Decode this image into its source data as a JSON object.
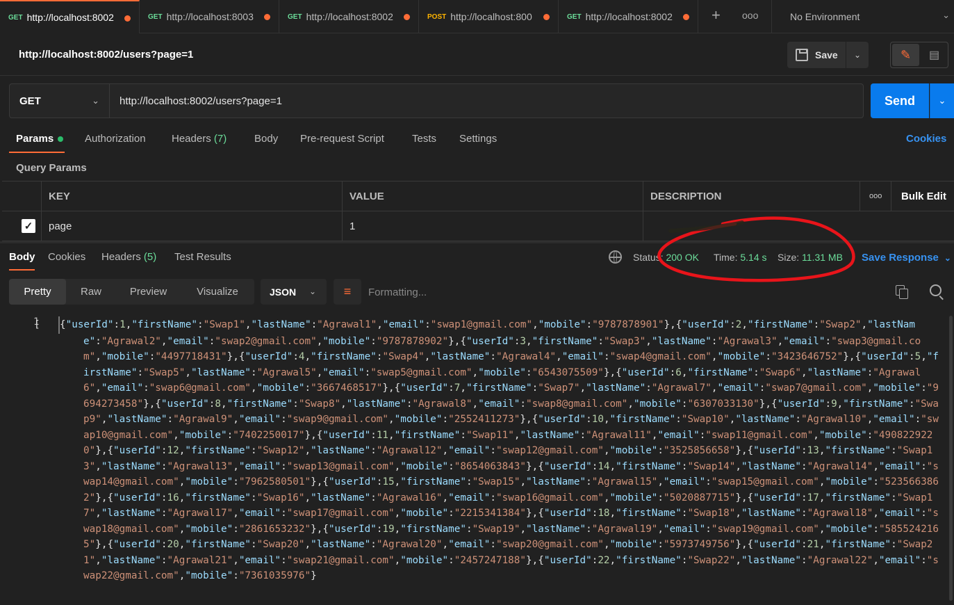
{
  "tabs": [
    {
      "method": "GET",
      "url": "http://localhost:8002",
      "active": true
    },
    {
      "method": "GET",
      "url": "http://localhost:8003",
      "active": false
    },
    {
      "method": "GET",
      "url": "http://localhost:8002",
      "active": false
    },
    {
      "method": "POST",
      "url": "http://localhost:800",
      "active": false
    },
    {
      "method": "GET",
      "url": "http://localhost:8002",
      "active": false
    }
  ],
  "tab_actions": {
    "new_tab_icon": "plus-icon",
    "more_icon": "ellipsis-icon"
  },
  "environment": {
    "label": "No Environment"
  },
  "request": {
    "title": "http://localhost:8002/users?page=1",
    "save_label": "Save",
    "method": "GET",
    "url": "http://localhost:8002/users?page=1",
    "send_label": "Send"
  },
  "request_tabs": {
    "params": "Params",
    "authorization": "Authorization",
    "headers": "Headers",
    "headers_count": "(7)",
    "body": "Body",
    "prerequest": "Pre-request Script",
    "tests": "Tests",
    "settings": "Settings",
    "cookies": "Cookies"
  },
  "query_params": {
    "section_title": "Query Params",
    "headers": {
      "key": "KEY",
      "value": "VALUE",
      "description": "DESCRIPTION",
      "bulk_edit": "Bulk Edit"
    },
    "rows": [
      {
        "checked": true,
        "key": "page",
        "value": "1",
        "description": ""
      }
    ]
  },
  "response_tabs": {
    "body": "Body",
    "cookies": "Cookies",
    "headers": "Headers",
    "headers_count": "(5)",
    "test_results": "Test Results"
  },
  "response_status": {
    "status_label": "Status:",
    "status_value": "200 OK",
    "time_label": "Time:",
    "time_value": "5.14 s",
    "size_label": "Size:",
    "size_value": "11.31 MB",
    "save_response": "Save Response"
  },
  "response_view": {
    "modes": [
      "Pretty",
      "Raw",
      "Preview",
      "Visualize"
    ],
    "active_mode": "Pretty",
    "format": "JSON",
    "formatting_text": "Formatting..."
  },
  "response_body": {
    "line_number": "1",
    "users": [
      {
        "userId": 1,
        "firstName": "Swap1",
        "lastName": "Agrawal1",
        "email": "swap1@gmail.com",
        "mobile": "9787878901"
      },
      {
        "userId": 2,
        "firstName": "Swap2",
        "lastName": "Agrawal2",
        "email": "swap2@gmail.com",
        "mobile": "9787878902"
      },
      {
        "userId": 3,
        "firstName": "Swap3",
        "lastName": "Agrawal3",
        "email": "swap3@gmail.com",
        "mobile": "4497718431"
      },
      {
        "userId": 4,
        "firstName": "Swap4",
        "lastName": "Agrawal4",
        "email": "swap4@gmail.com",
        "mobile": "3423646752"
      },
      {
        "userId": 5,
        "firstName": "Swap5",
        "lastName": "Agrawal5",
        "email": "swap5@gmail.com",
        "mobile": "6543075509"
      },
      {
        "userId": 6,
        "firstName": "Swap6",
        "lastName": "Agrawal6",
        "email": "swap6@gmail.com",
        "mobile": "3667468517"
      },
      {
        "userId": 7,
        "firstName": "Swap7",
        "lastName": "Agrawal7",
        "email": "swap7@gmail.com",
        "mobile": "9694273458"
      },
      {
        "userId": 8,
        "firstName": "Swap8",
        "lastName": "Agrawal8",
        "email": "swap8@gmail.com",
        "mobile": "6307033130"
      },
      {
        "userId": 9,
        "firstName": "Swap9",
        "lastName": "Agrawal9",
        "email": "swap9@gmail.com",
        "mobile": "2552411273"
      },
      {
        "userId": 10,
        "firstName": "Swap10",
        "lastName": "Agrawal10",
        "email": "swap10@gmail.com",
        "mobile": "7402250017"
      },
      {
        "userId": 11,
        "firstName": "Swap11",
        "lastName": "Agrawal11",
        "email": "swap11@gmail.com",
        "mobile": "4908229220"
      },
      {
        "userId": 12,
        "firstName": "Swap12",
        "lastName": "Agrawal12",
        "email": "swap12@gmail.com",
        "mobile": "3525856658"
      },
      {
        "userId": 13,
        "firstName": "Swap13",
        "lastName": "Agrawal13",
        "email": "swap13@gmail.com",
        "mobile": "8654063843"
      },
      {
        "userId": 14,
        "firstName": "Swap14",
        "lastName": "Agrawal14",
        "email": "swap14@gmail.com",
        "mobile": "7962580501"
      },
      {
        "userId": 15,
        "firstName": "Swap15",
        "lastName": "Agrawal15",
        "email": "swap15@gmail.com",
        "mobile": "5235663862"
      },
      {
        "userId": 16,
        "firstName": "Swap16",
        "lastName": "Agrawal16",
        "email": "swap16@gmail.com",
        "mobile": "5020887715"
      },
      {
        "userId": 17,
        "firstName": "Swap17",
        "lastName": "Agrawal17",
        "email": "swap17@gmail.com",
        "mobile": "2215341384"
      },
      {
        "userId": 18,
        "firstName": "Swap18",
        "lastName": "Agrawal18",
        "email": "swap18@gmail.com",
        "mobile": "2861653232"
      },
      {
        "userId": 19,
        "firstName": "Swap19",
        "lastName": "Agrawal19",
        "email": "swap19@gmail.com",
        "mobile": "5855242165"
      },
      {
        "userId": 20,
        "firstName": "Swap20",
        "lastName": "Agrawal20",
        "email": "swap20@gmail.com",
        "mobile": "5973749756"
      },
      {
        "userId": 21,
        "firstName": "Swap21",
        "lastName": "Agrawal21",
        "email": "swap21@gmail.com",
        "mobile": "2457247188"
      },
      {
        "userId": 22,
        "firstName": "Swap22",
        "lastName": "Agrawal22",
        "email": "swap22@gmail.com",
        "mobile": "7361035976"
      }
    ]
  },
  "colors": {
    "accent": "#ff6c37",
    "send": "#097bed",
    "success": "#6bdd9a",
    "link": "#3792f1",
    "annotation": "#e8141a"
  }
}
